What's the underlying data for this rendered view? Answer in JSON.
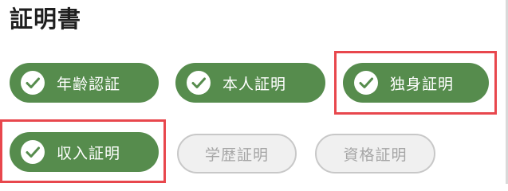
{
  "section": {
    "title": "証明書"
  },
  "chips": [
    {
      "label": "年齢認証",
      "selected": true,
      "highlighted": false
    },
    {
      "label": "本人証明",
      "selected": true,
      "highlighted": false
    },
    {
      "label": "独身証明",
      "selected": true,
      "highlighted": true
    },
    {
      "label": "収入証明",
      "selected": true,
      "highlighted": true
    },
    {
      "label": "学歴証明",
      "selected": false,
      "highlighted": false
    },
    {
      "label": "資格証明",
      "selected": false,
      "highlighted": false
    }
  ],
  "colors": {
    "selected_chip": "#568c4d",
    "unselected_chip": "#f0f0f0",
    "unselected_border": "#c8c8c8",
    "unselected_text": "#a6a6a6",
    "highlight_border": "#e8474d",
    "title_text": "#1f1f1f"
  },
  "icons": {
    "selected": "check-circle-icon"
  }
}
